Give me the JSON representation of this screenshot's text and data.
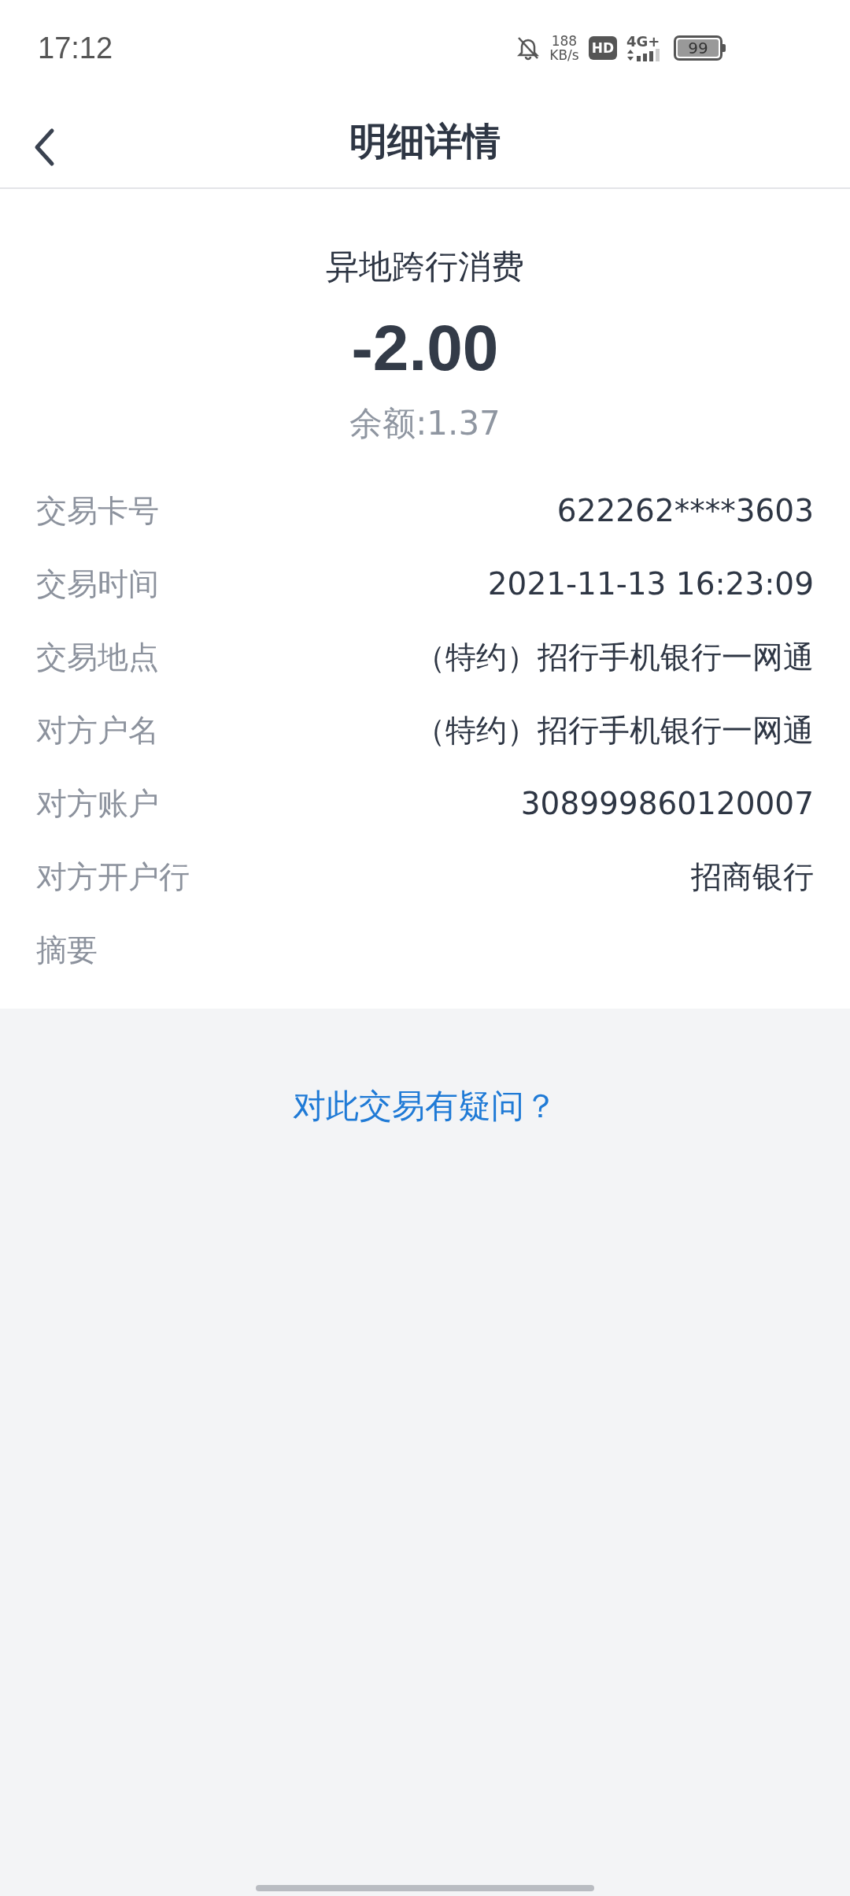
{
  "status_bar": {
    "time": "17:12",
    "net_speed": "188",
    "net_unit": "KB/s",
    "hd_badge": "HD",
    "network": "4G+",
    "battery": "99"
  },
  "nav": {
    "title": "明细详情"
  },
  "summary": {
    "type": "异地跨行消费",
    "amount": "-2.00",
    "balance": "余额:1.37"
  },
  "details": [
    {
      "label": "交易卡号",
      "value": "622262****3603"
    },
    {
      "label": "交易时间",
      "value": "2021-11-13 16:23:09"
    },
    {
      "label": "交易地点",
      "value": "（特约）招行手机银行一网通"
    },
    {
      "label": "对方户名",
      "value": "（特约）招行手机银行一网通"
    },
    {
      "label": "对方账户",
      "value": "308999860120007"
    },
    {
      "label": "对方开户行",
      "value": "招商银行"
    },
    {
      "label": "摘要"
    }
  ],
  "help_link": "对此交易有疑问？"
}
